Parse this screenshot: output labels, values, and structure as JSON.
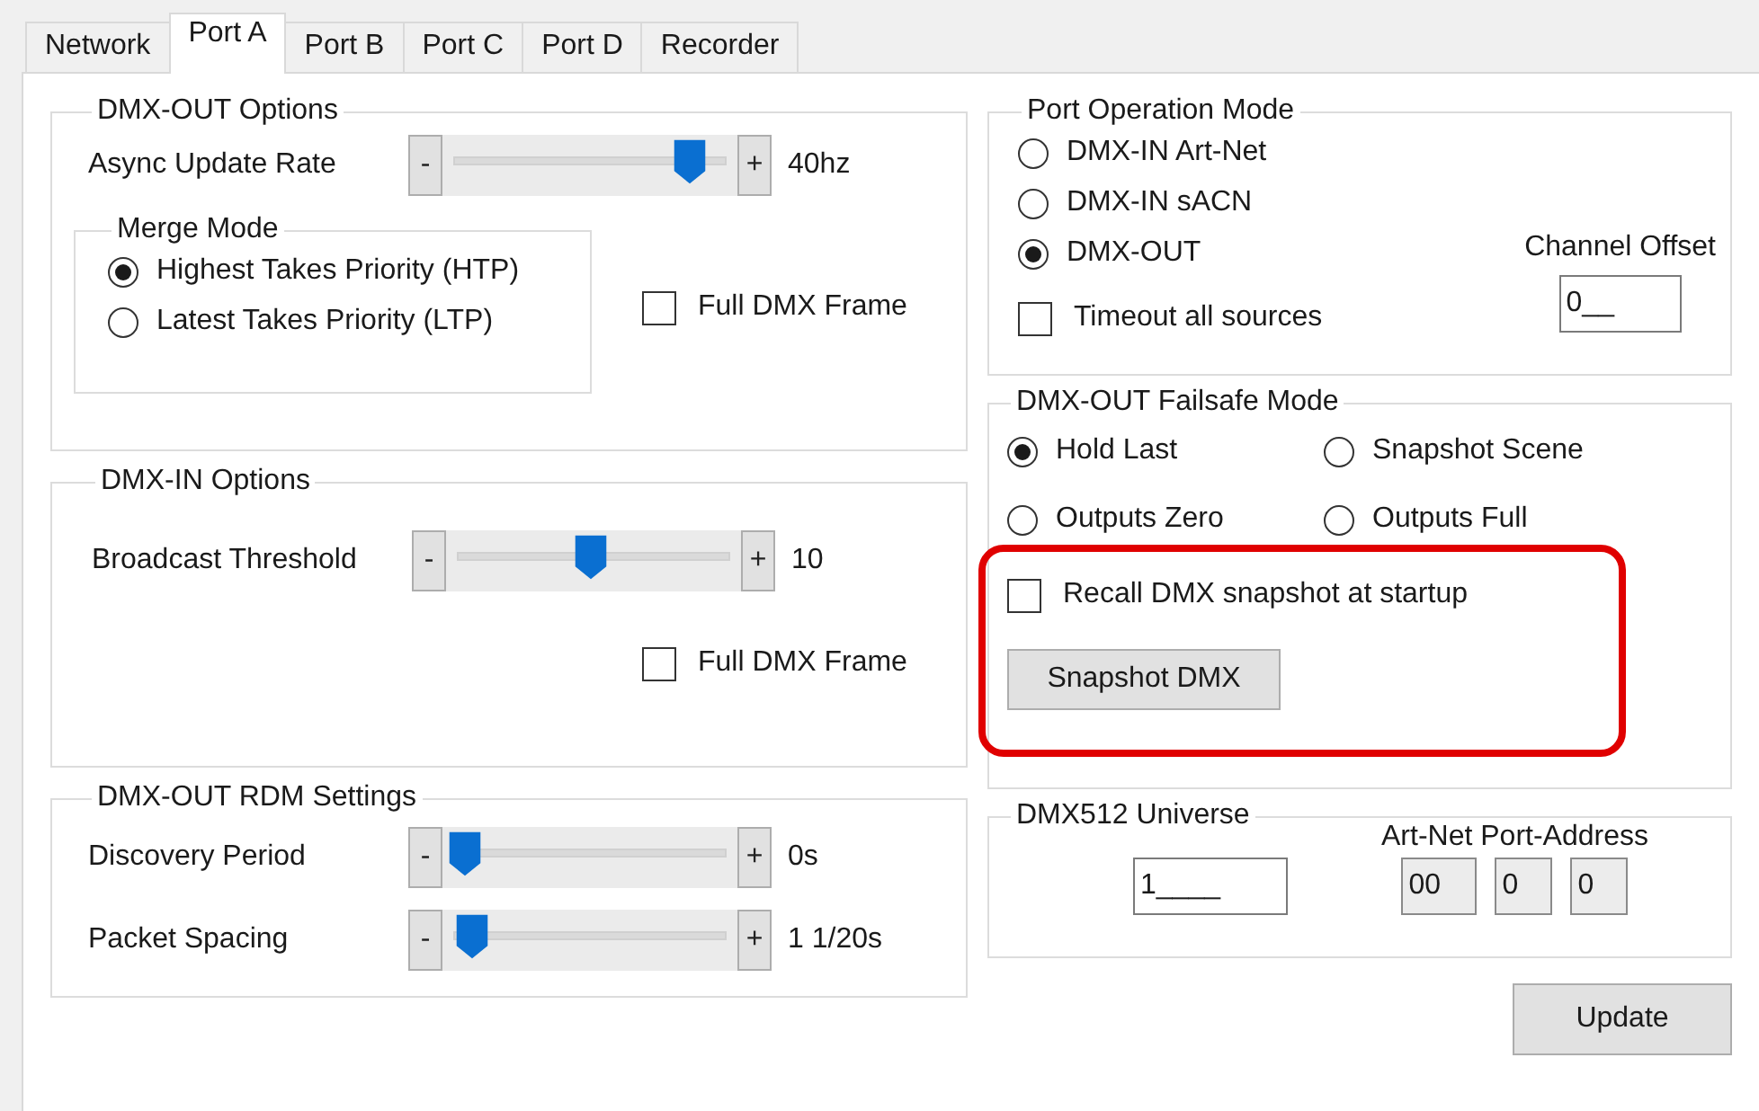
{
  "tabs": [
    {
      "label": "Network",
      "selected": false
    },
    {
      "label": "Port A",
      "selected": true
    },
    {
      "label": "Port B",
      "selected": false
    },
    {
      "label": "Port C",
      "selected": false
    },
    {
      "label": "Port D",
      "selected": false
    },
    {
      "label": "Recorder",
      "selected": false
    }
  ],
  "dmx_out_options": {
    "title": "DMX-OUT Options",
    "sliders": [
      {
        "label": "Async Update Rate",
        "minus": "-",
        "plus": "+",
        "level": 0.92,
        "reading": "40hz"
      }
    ],
    "merge_mode": {
      "title": "Merge Mode",
      "options": [
        {
          "label": "Highest Takes Priority (HTP)",
          "selected": true
        },
        {
          "label": "Latest Takes Priority (LTP)",
          "selected": false
        }
      ]
    },
    "full_frame": {
      "label": "Full DMX Frame",
      "checked": false
    }
  },
  "dmx_in_options": {
    "title": "DMX-IN Options",
    "sliders": [
      {
        "label": "Broadcast Threshold",
        "minus": "-",
        "plus": "+",
        "level": 0.5,
        "reading": "10"
      }
    ],
    "full_frame": {
      "label": "Full DMX Frame",
      "checked": false
    }
  },
  "rdm_settings": {
    "title": "DMX-OUT RDM Settings",
    "sliders": [
      {
        "label": "Discovery Period",
        "minus": "-",
        "plus": "+",
        "level": 0,
        "reading": "0s"
      },
      {
        "label": "Packet Spacing",
        "minus": "-",
        "plus": "+",
        "level": 0.03,
        "reading": "1 1/20s"
      }
    ]
  },
  "port_operation_mode": {
    "title": "Port Operation Mode",
    "options": [
      {
        "label": "DMX-IN Art-Net",
        "selected": false
      },
      {
        "label": "DMX-IN sACN",
        "selected": false
      },
      {
        "label": "DMX-OUT",
        "selected": true
      }
    ],
    "timeout": {
      "label": "Timeout all sources",
      "checked": false
    },
    "channel_offset": {
      "label": "Channel Offset",
      "value": "0__"
    }
  },
  "failsafe": {
    "title": "DMX-OUT Failsafe Mode",
    "options": [
      {
        "label": "Hold Last",
        "selected": true
      },
      {
        "label": "Snapshot Scene",
        "selected": false
      },
      {
        "label": "Outputs Zero",
        "selected": false
      },
      {
        "label": "Outputs Full",
        "selected": false
      }
    ],
    "recall": {
      "label": "Recall DMX snapshot at startup",
      "checked": false
    },
    "snapshot_button": "Snapshot DMX",
    "highlighted": true
  },
  "universe": {
    "title": "DMX512 Universe",
    "value": "1____",
    "port_address": {
      "label": "Art-Net Port-Address",
      "values": [
        "00",
        "0",
        "0"
      ]
    }
  },
  "update_button": "Update"
}
